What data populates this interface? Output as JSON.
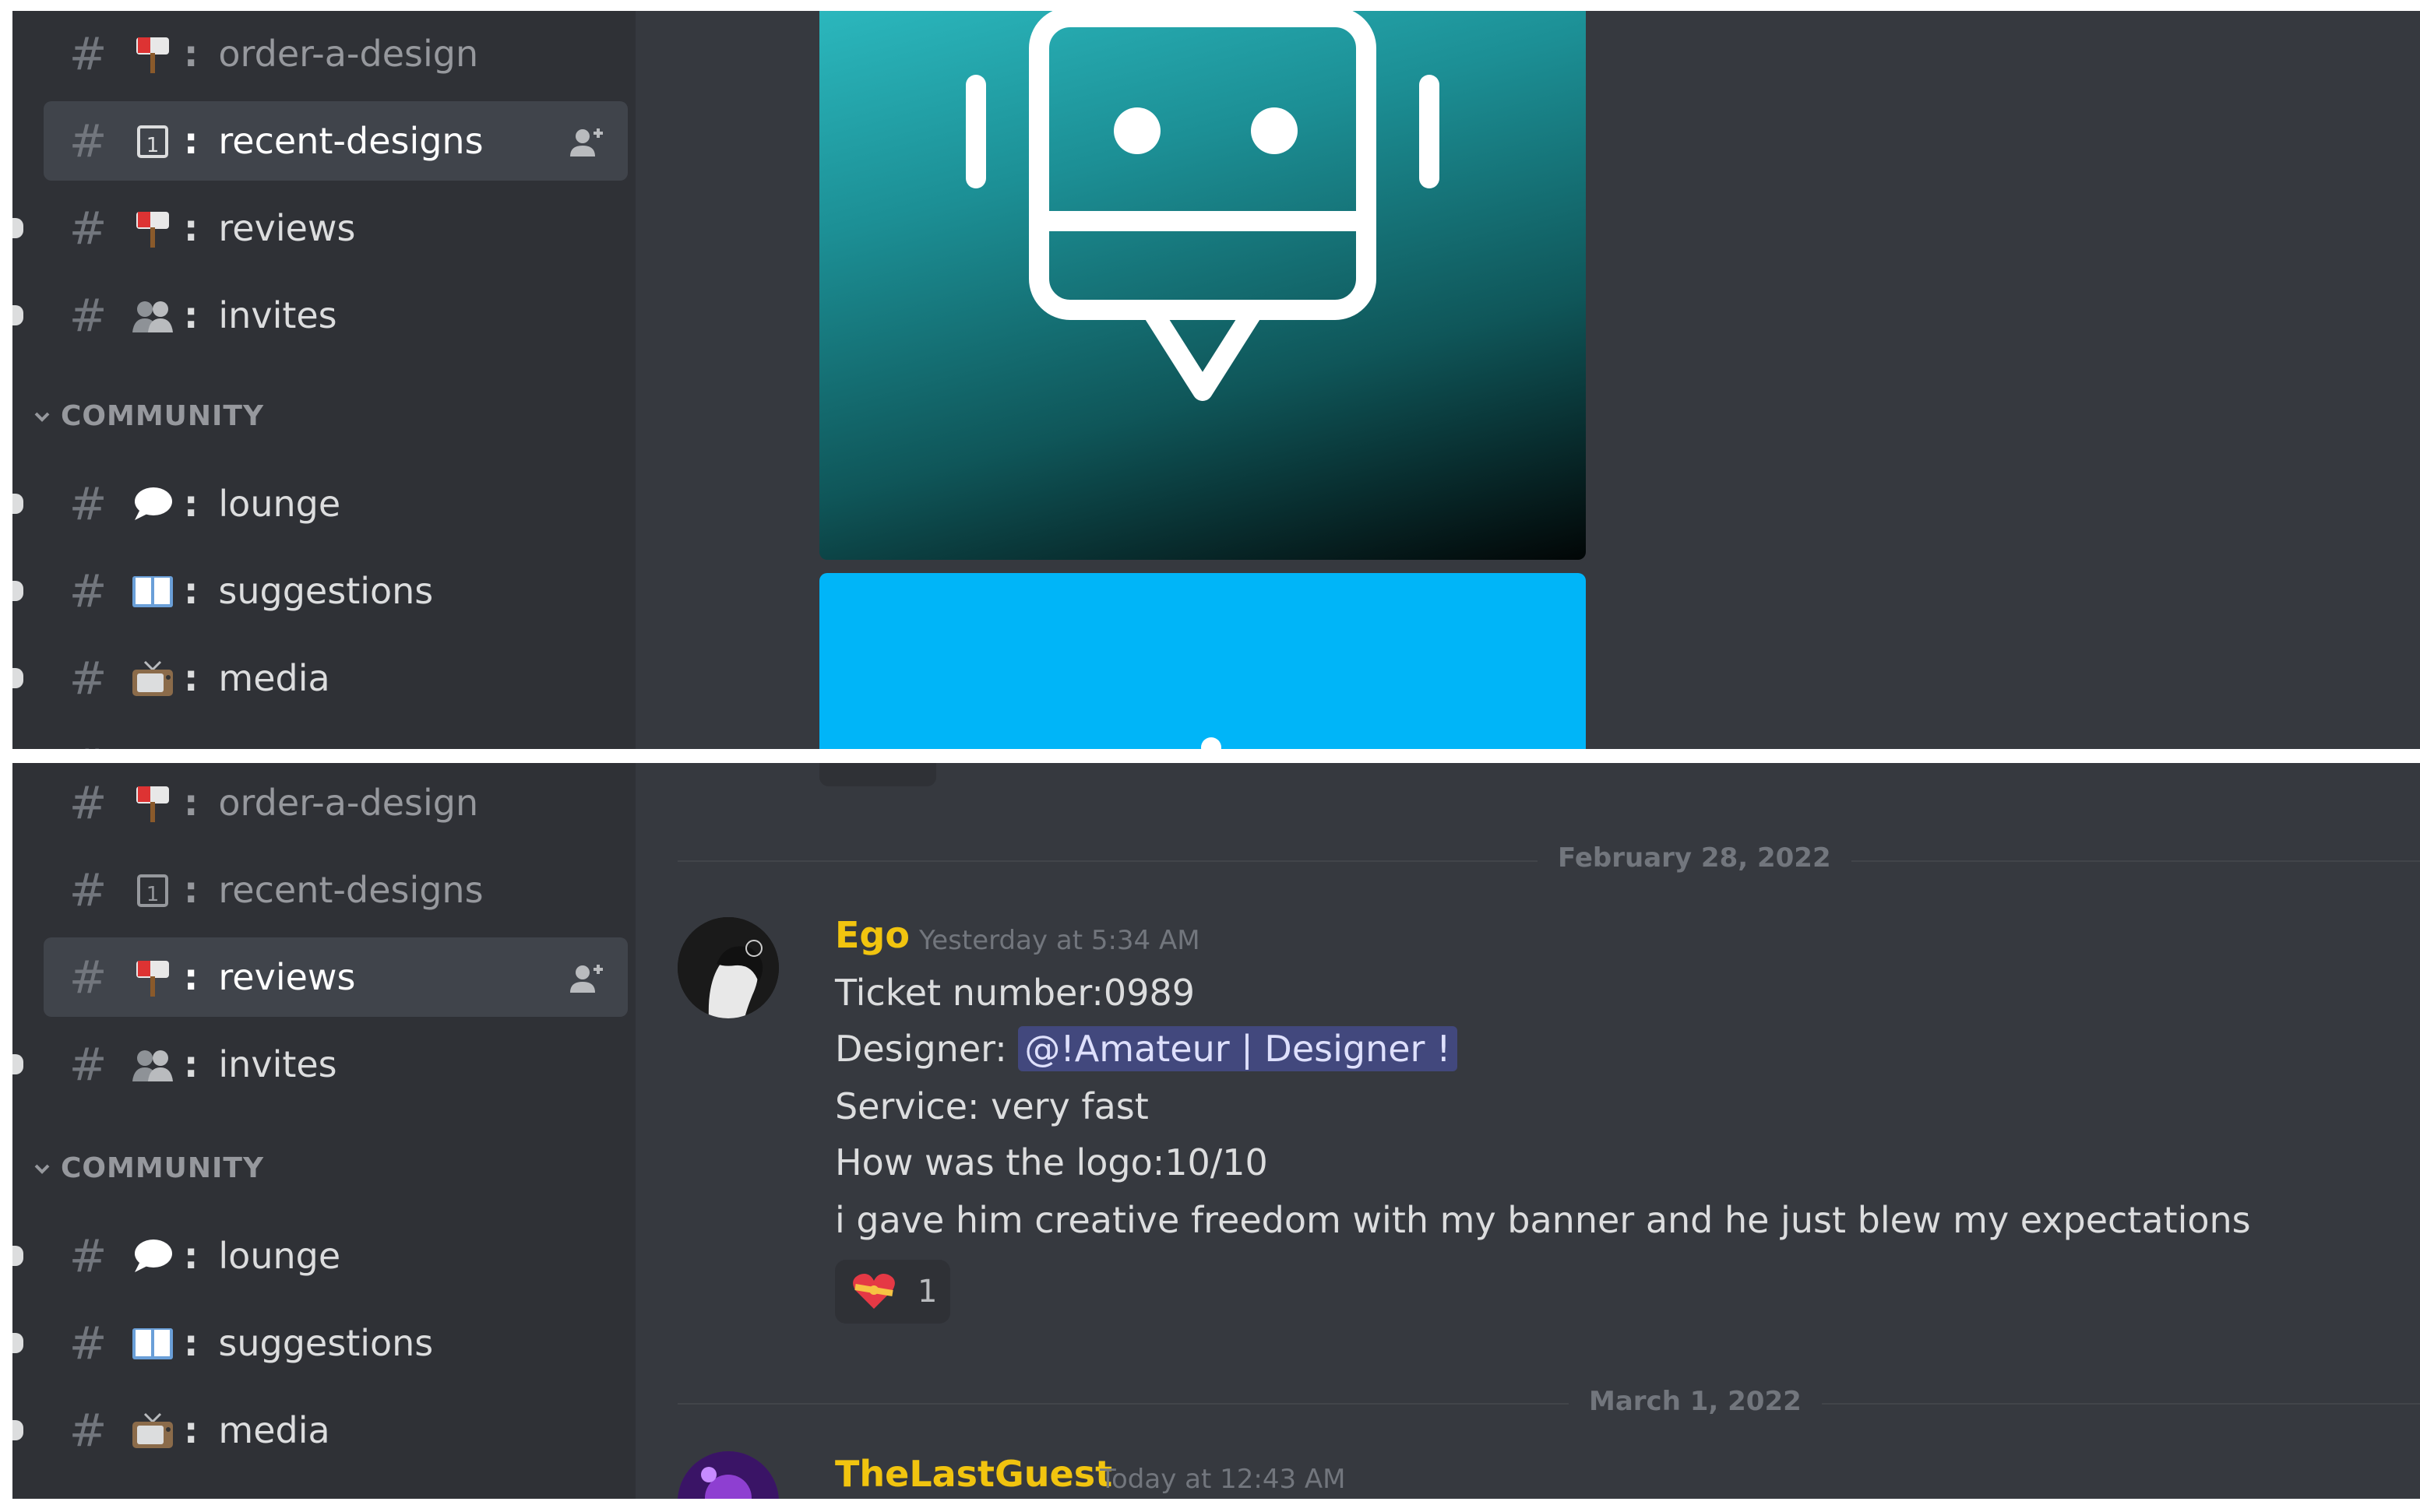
{
  "top_panel": {
    "channels": [
      {
        "name": "order-a-design",
        "emoji": "mailbox-icon",
        "state": "muted"
      },
      {
        "name": "recent-designs",
        "emoji": "calendar-icon",
        "state": "active"
      },
      {
        "name": "reviews",
        "emoji": "mailbox-icon",
        "state": "unread"
      },
      {
        "name": "invites",
        "emoji": "people-icon",
        "state": "unread"
      },
      {
        "name": "lounge",
        "emoji": "speech-bubble-icon",
        "state": "unread"
      },
      {
        "name": "suggestions",
        "emoji": "book-icon",
        "state": "unread"
      },
      {
        "name": "media",
        "emoji": "television-icon",
        "state": "unread"
      }
    ],
    "category": "COMMUNITY"
  },
  "bottom_panel": {
    "channels": [
      {
        "name": "order-a-design",
        "emoji": "mailbox-icon",
        "state": "muted"
      },
      {
        "name": "recent-designs",
        "emoji": "calendar-icon",
        "state": "muted"
      },
      {
        "name": "reviews",
        "emoji": "mailbox-icon",
        "state": "active"
      },
      {
        "name": "invites",
        "emoji": "people-icon",
        "state": "unread"
      },
      {
        "name": "lounge",
        "emoji": "speech-bubble-icon",
        "state": "unread"
      },
      {
        "name": "suggestions",
        "emoji": "book-icon",
        "state": "unread"
      },
      {
        "name": "media",
        "emoji": "television-icon",
        "state": "unread"
      }
    ],
    "category": "COMMUNITY"
  },
  "chat": {
    "dividers": [
      "February 28, 2022",
      "March 1, 2022"
    ],
    "message": {
      "author": "Ego",
      "author_color": "#f1c40f",
      "timestamp": "Yesterday at 5:34 AM",
      "line1": "Ticket number:0989",
      "line2_prefix": "Designer: ",
      "mention": "@!Amateur | Designer !",
      "line3": "Service: very fast",
      "line4": "How was the logo:10/10",
      "line5": "i gave him creative freedom with my banner and he just blew my expectations",
      "reaction_emoji": "heart-with-ribbon-icon",
      "reaction_count": "1"
    },
    "next_message": {
      "author": "TheLastGuest",
      "author_color": "#f1c40f",
      "timestamp": "Today at 12:43 AM"
    }
  },
  "colors": {
    "sidebar": "#2f3136",
    "chat_bg": "#36393f",
    "active_channel": "#40444b",
    "mention_bg": "#5865f2",
    "banner": "#00b5f8"
  }
}
